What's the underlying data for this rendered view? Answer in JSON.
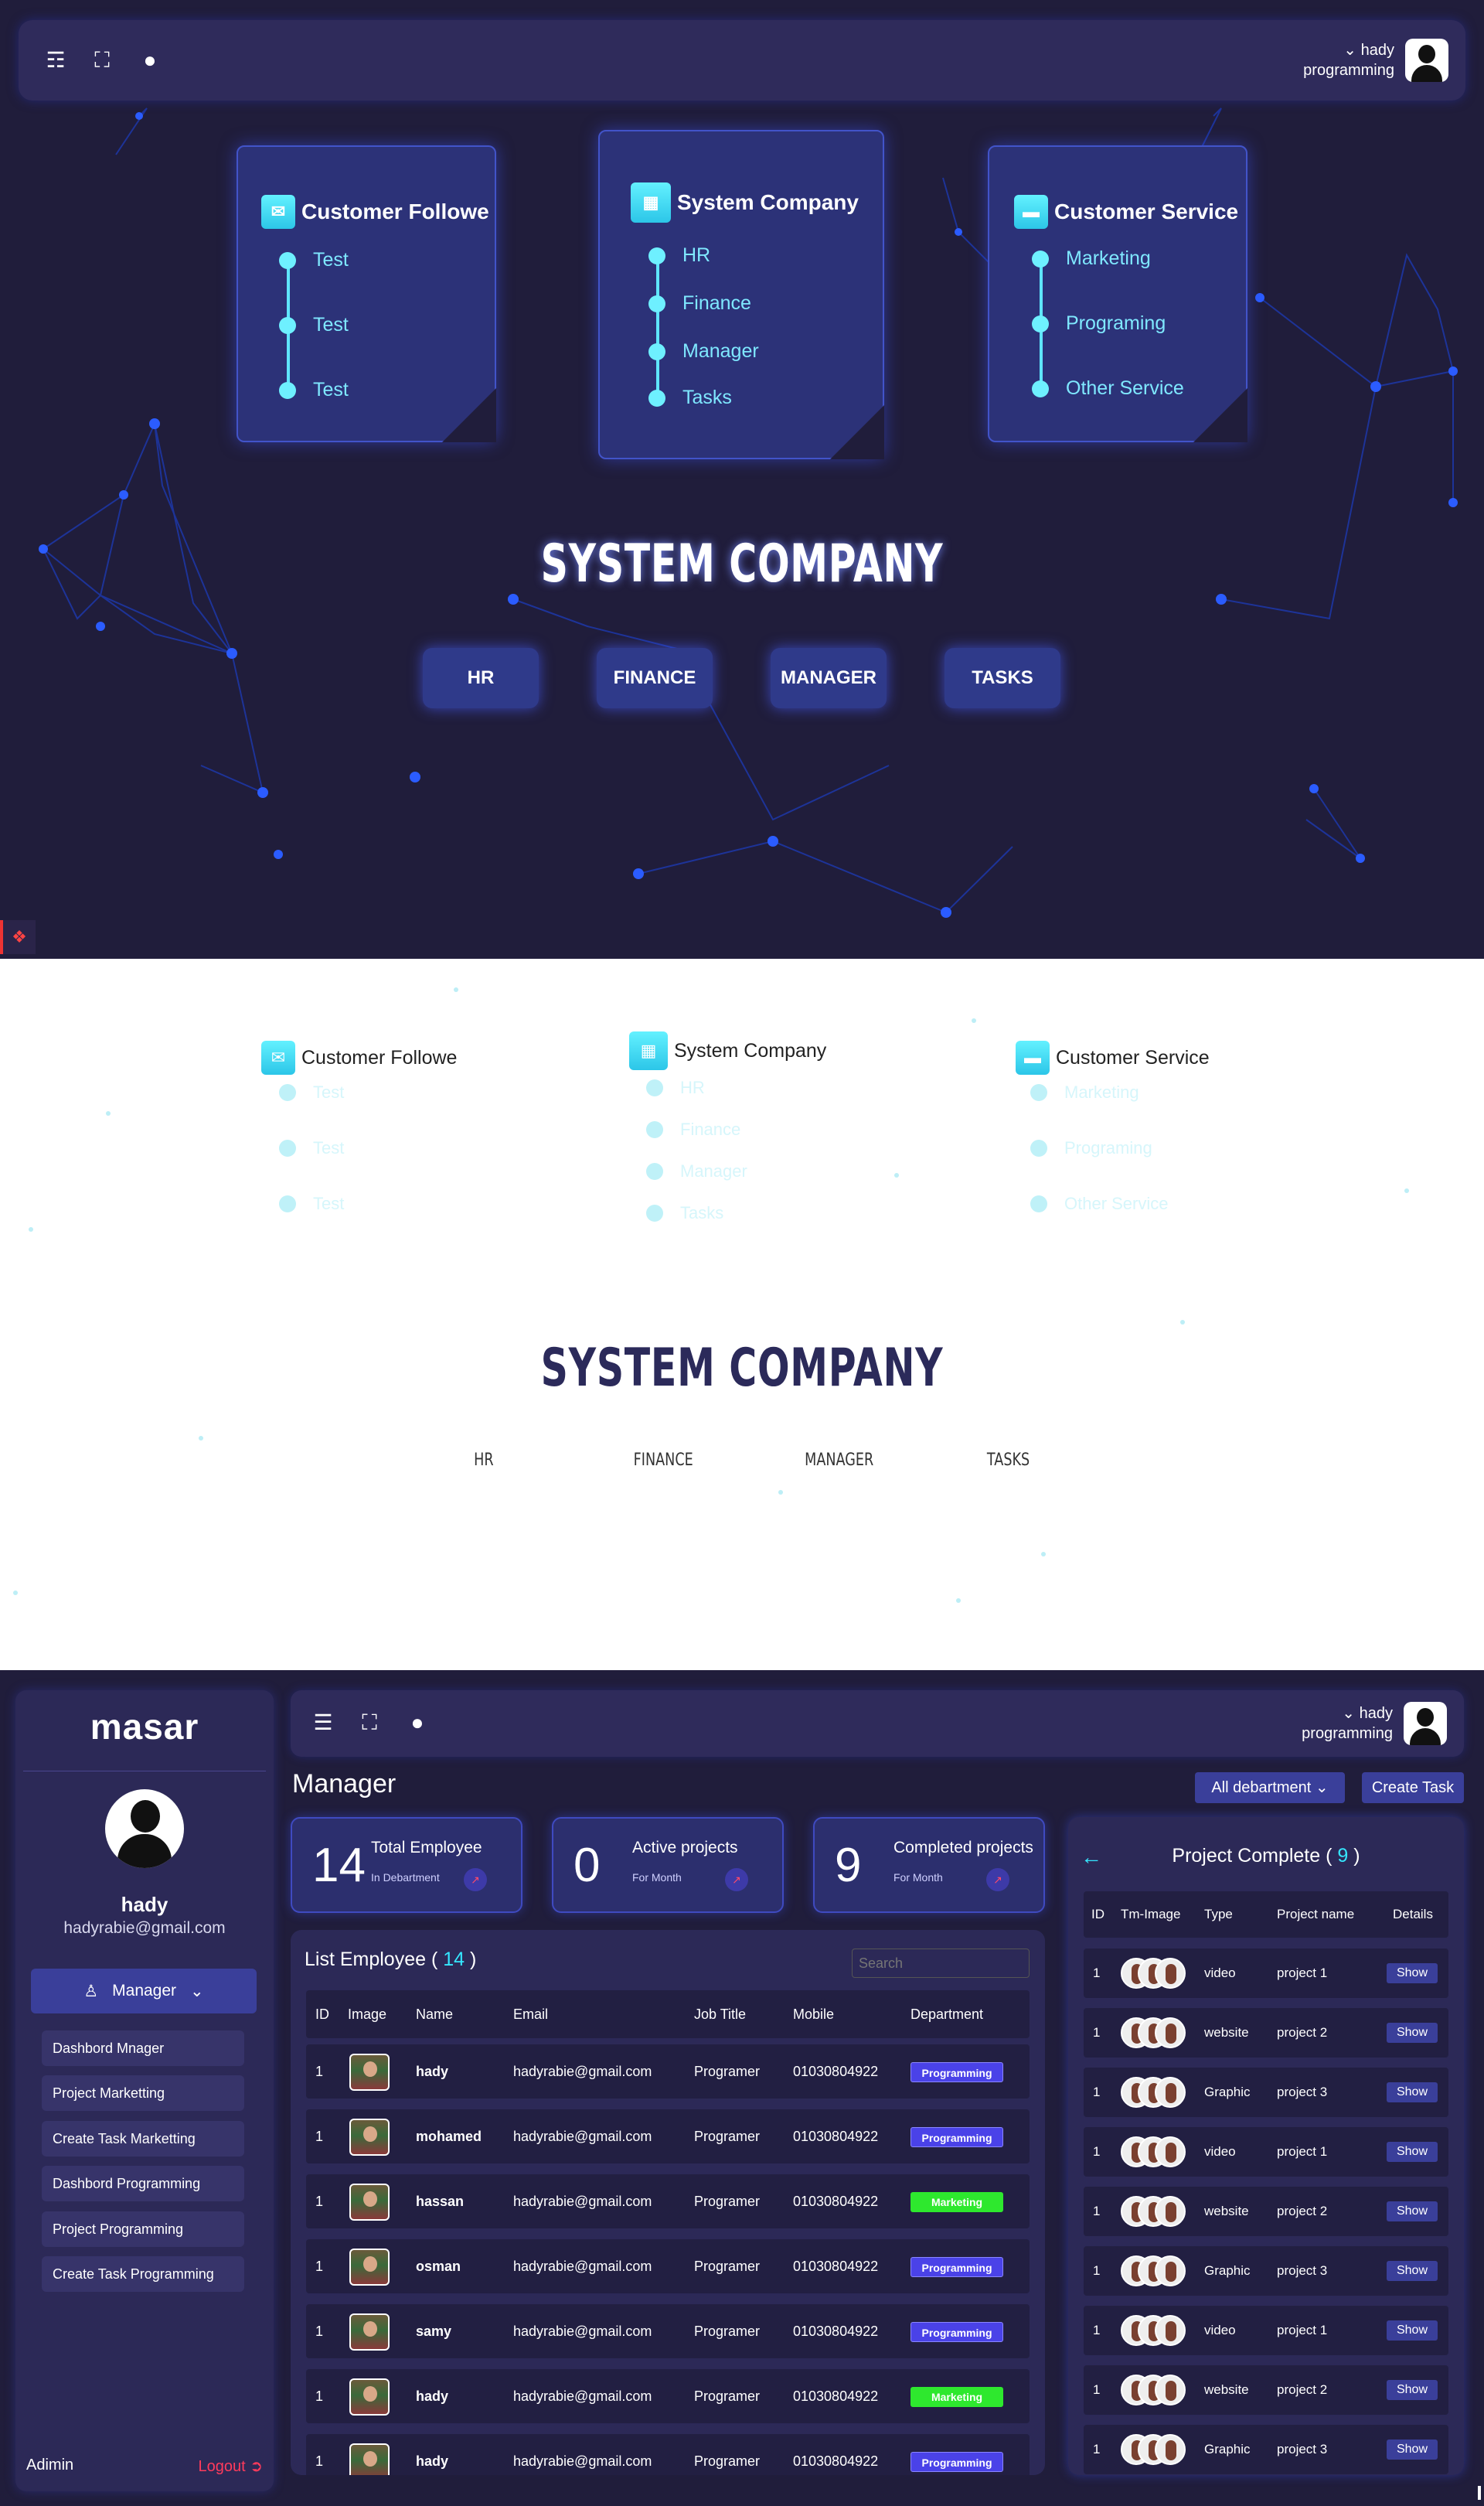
{
  "topbar": {
    "icons": [
      "book-icon",
      "fullscreen-icon",
      "lightbulb-icon"
    ],
    "user_name": "hady",
    "user_role": "programming"
  },
  "cards": [
    {
      "title": "Customer Followe",
      "items": [
        "Test",
        "Test",
        "Test"
      ]
    },
    {
      "title": "System Company",
      "items": [
        "HR",
        "Finance",
        "Manager",
        "Tasks"
      ]
    },
    {
      "title": "Customer Service",
      "items": [
        "Marketing",
        "Programing",
        "Other Service"
      ]
    }
  ],
  "hero": {
    "title": "SYSTEM COMPANY",
    "buttons": [
      "HR",
      "FINANCE",
      "MANAGER",
      "TASKS"
    ]
  },
  "light": {
    "title": "SYSTEM COMPANY",
    "links": [
      "HR",
      "FINANCE",
      "MANAGER",
      "TASKS"
    ]
  },
  "dashboard": {
    "logo": "masar",
    "profile": {
      "name": "hady",
      "email": "hadyrabie@gmail.com"
    },
    "role": "Manager",
    "menu": [
      "Dashbord Mnager",
      "Project Marketting",
      "Create Task Marketting",
      "Dashbord Programming",
      "Project Programming",
      "Create Task Programming"
    ],
    "footer": {
      "left": "Adimin",
      "right": "Logout"
    },
    "page_title": "Manager",
    "filter": "All debartment",
    "create_task": "Create Task",
    "stats": [
      {
        "value": "14",
        "label": "Total Employee",
        "sub": "In Debartment"
      },
      {
        "value": "0",
        "label": "Active projects",
        "sub": "For Month"
      },
      {
        "value": "9",
        "label": "Completed projects",
        "sub": "For Month"
      }
    ],
    "employees": {
      "title": "List Employee (",
      "count": "14",
      "title_end": ")",
      "search_placeholder": "Search",
      "columns": [
        "ID",
        "Image",
        "Name",
        "Email",
        "Job Title",
        "Mobile",
        "Department"
      ],
      "rows": [
        {
          "id": "1",
          "name": "hady",
          "email": "hadyrabie@gmail.com",
          "job": "Programer",
          "mobile": "01030804922",
          "dept": "Programming"
        },
        {
          "id": "1",
          "name": "mohamed",
          "email": "hadyrabie@gmail.com",
          "job": "Programer",
          "mobile": "01030804922",
          "dept": "Programming"
        },
        {
          "id": "1",
          "name": "hassan",
          "email": "hadyrabie@gmail.com",
          "job": "Programer",
          "mobile": "01030804922",
          "dept": "Marketing"
        },
        {
          "id": "1",
          "name": "osman",
          "email": "hadyrabie@gmail.com",
          "job": "Programer",
          "mobile": "01030804922",
          "dept": "Programming"
        },
        {
          "id": "1",
          "name": "samy",
          "email": "hadyrabie@gmail.com",
          "job": "Programer",
          "mobile": "01030804922",
          "dept": "Programming"
        },
        {
          "id": "1",
          "name": "hady",
          "email": "hadyrabie@gmail.com",
          "job": "Programer",
          "mobile": "01030804922",
          "dept": "Marketing"
        },
        {
          "id": "1",
          "name": "hady",
          "email": "hadyrabie@gmail.com",
          "job": "Programer",
          "mobile": "01030804922",
          "dept": "Programming"
        }
      ]
    },
    "projects": {
      "title": "Project Complete (",
      "count": "9",
      "title_end": ")",
      "columns": [
        "ID",
        "Tm-Image",
        "Type",
        "Project name",
        "Details"
      ],
      "rows": [
        {
          "id": "1",
          "type": "video",
          "name": "project 1",
          "btn": "Show"
        },
        {
          "id": "1",
          "type": "website",
          "name": "project 2",
          "btn": "Show"
        },
        {
          "id": "1",
          "type": "Graphic",
          "name": "project 3",
          "btn": "Show"
        },
        {
          "id": "1",
          "type": "video",
          "name": "project 1",
          "btn": "Show"
        },
        {
          "id": "1",
          "type": "website",
          "name": "project 2",
          "btn": "Show"
        },
        {
          "id": "1",
          "type": "Graphic",
          "name": "project 3",
          "btn": "Show"
        },
        {
          "id": "1",
          "type": "video",
          "name": "project 1",
          "btn": "Show"
        },
        {
          "id": "1",
          "type": "website",
          "name": "project 2",
          "btn": "Show"
        },
        {
          "id": "1",
          "type": "Graphic",
          "name": "project 3",
          "btn": "Show"
        }
      ]
    }
  },
  "colors": {
    "accent": "#35e7ff",
    "bg": "#201d3b",
    "panel": "#2c2957",
    "programming": "#4a42e8",
    "marketing": "#2ee82e",
    "logout": "#ff3b5c"
  }
}
